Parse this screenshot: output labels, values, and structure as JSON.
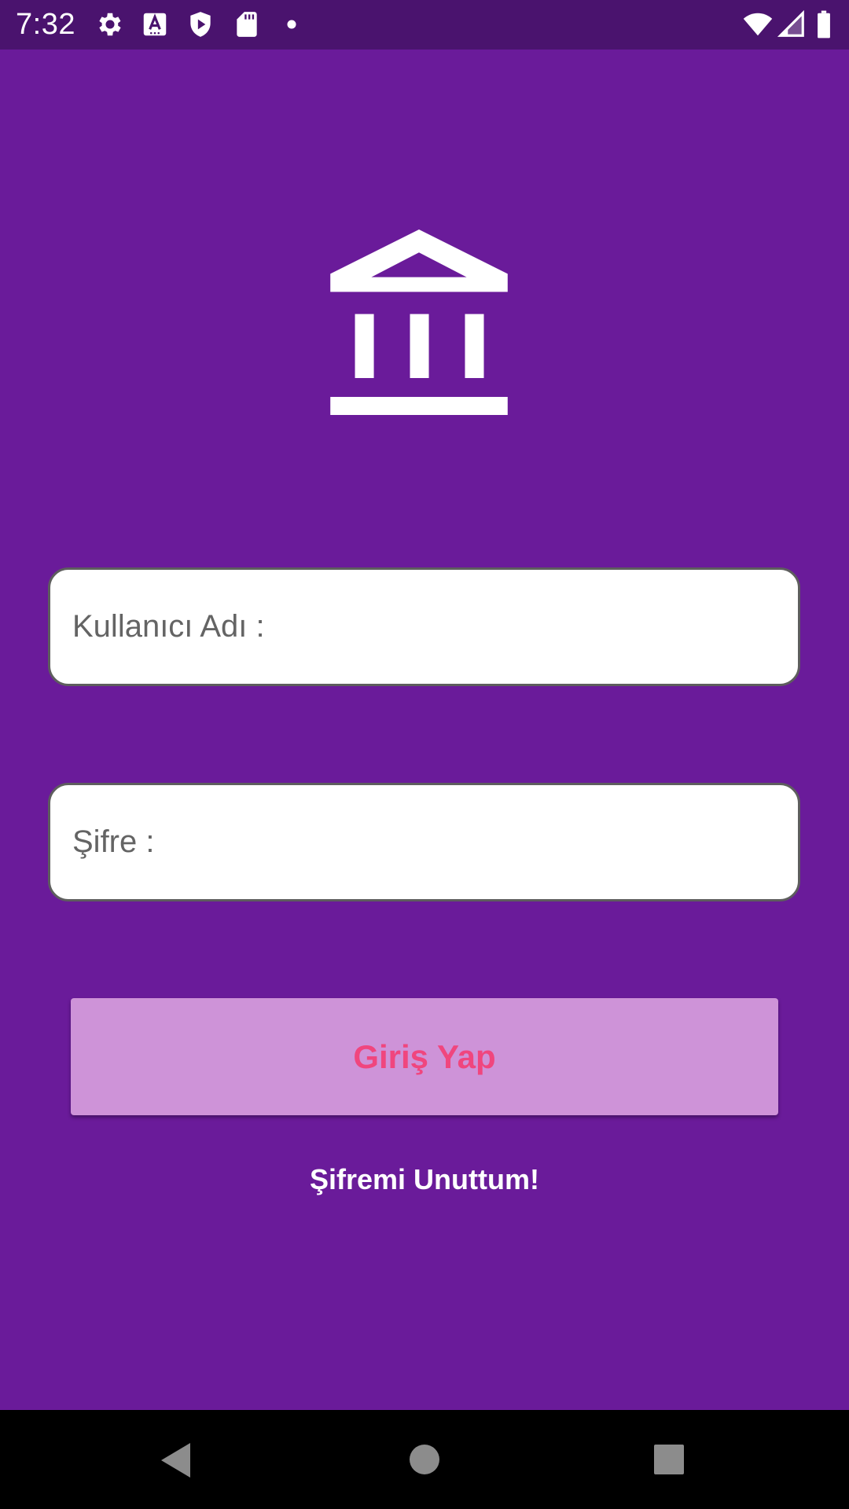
{
  "status_bar": {
    "time": "7:32",
    "left_icons": [
      "gear-icon",
      "translate-a-icon",
      "play-shield-icon",
      "sd-card-icon",
      "dot-icon"
    ],
    "right_icons": [
      "wifi-icon",
      "signal-icon",
      "battery-icon"
    ]
  },
  "logo": {
    "icon": "bank-building-icon"
  },
  "form": {
    "username_placeholder": "Kullanıcı Adı :",
    "password_placeholder": "Şifre :",
    "username_value": "",
    "password_value": ""
  },
  "actions": {
    "login_label": "Giriş Yap",
    "forgot_label": "Şifremi Unuttum!"
  },
  "nav_bar": {
    "buttons": [
      "back-icon",
      "home-icon",
      "recents-icon"
    ]
  },
  "colors": {
    "background": "#6a1b9a",
    "status_bar": "#4a136e",
    "button_background": "#ce93d8",
    "button_text": "#f0467e",
    "nav_bar": "#000000"
  }
}
